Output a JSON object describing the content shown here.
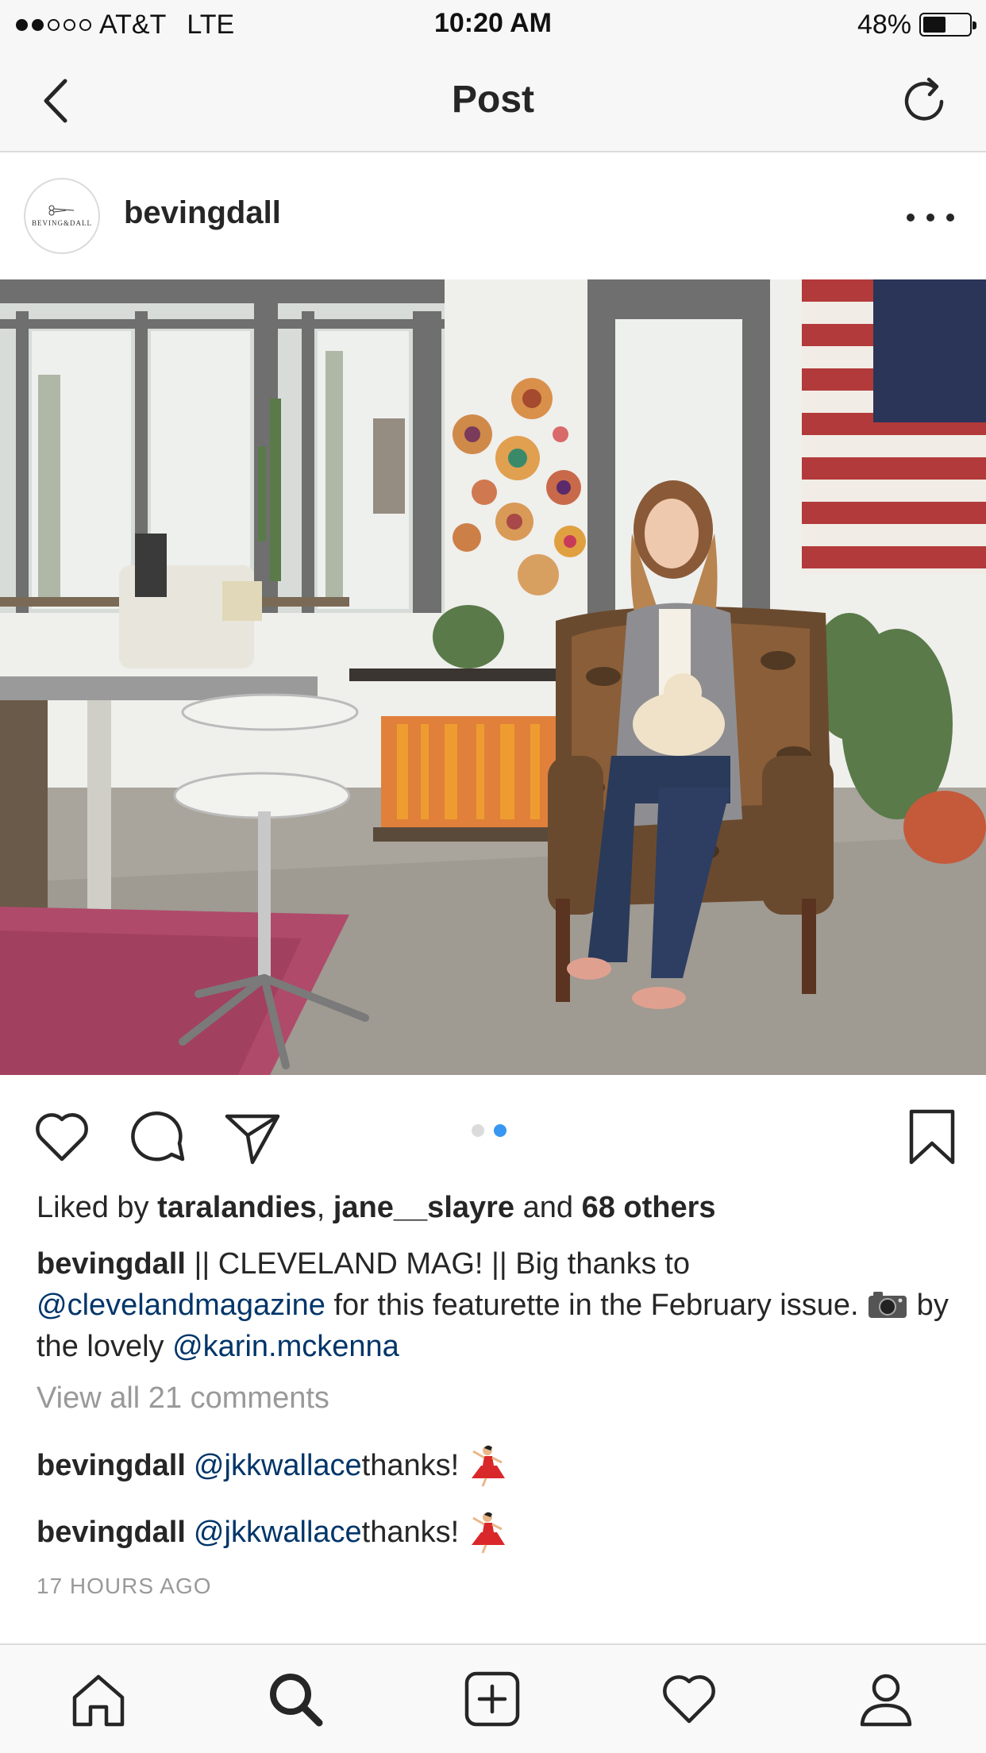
{
  "status_bar": {
    "carrier": "AT&T",
    "network": "LTE",
    "time": "10:20 AM",
    "battery_percent_text": "48%",
    "battery_level": 0.48,
    "signal_bars_filled": 2,
    "signal_bars_total": 5
  },
  "nav": {
    "title": "Post",
    "back_icon": "chevron-left-icon",
    "refresh_icon": "refresh-icon"
  },
  "post": {
    "username": "bevingdall",
    "avatar_text": "BEVING&DALL",
    "more_icon": "more-horizontal-icon",
    "photo_description_icon": "post-photo",
    "carousel": {
      "count": 2,
      "active_index": 1
    },
    "likes": {
      "prefix": "Liked by ",
      "user1": "taralandies",
      "separator": ", ",
      "user2": "jane__slayre",
      "middle": " and ",
      "others": "68 others"
    },
    "caption": {
      "username": "bevingdall",
      "text1": " || CLEVELAND MAG! || Big thanks to ",
      "mention1": "@clevelandmagazine",
      "text2": " for this featurette in the February issue. ",
      "text3": " by the lovely ",
      "mention2": "@karin.mckenna"
    },
    "view_all_comments": "View all 21 comments",
    "comments": [
      {
        "username": "bevingdall",
        "mention": "@jkkwallace",
        "text": " thanks! "
      },
      {
        "username": "bevingdall",
        "mention": "@jkkwallace",
        "text": " thanks! "
      }
    ],
    "timestamp": "17 HOURS AGO"
  },
  "actions": {
    "like_icon": "heart-icon",
    "comment_icon": "comment-icon",
    "share_icon": "send-icon",
    "save_icon": "bookmark-icon"
  },
  "tab_bar": {
    "items": [
      "home-icon",
      "search-icon",
      "add-post-icon",
      "activity-heart-icon",
      "profile-icon"
    ],
    "active": "search-icon"
  },
  "colors": {
    "mention": "#003569",
    "secondary_text": "#999999",
    "carousel_active": "#3897f0",
    "bar_background": "#f7f7f7",
    "divider": "#dbdbdb"
  }
}
